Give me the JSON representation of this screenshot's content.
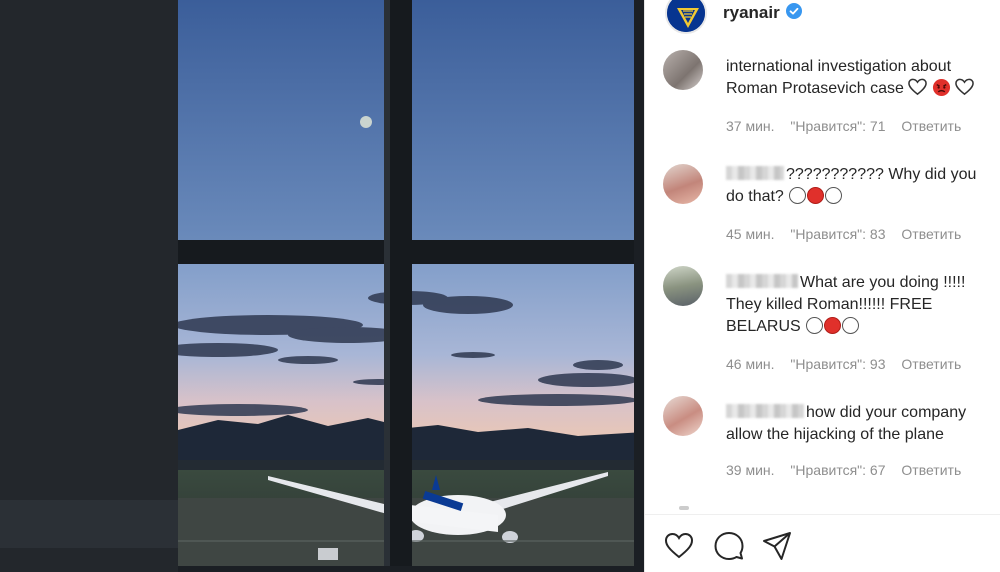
{
  "post": {
    "username": "ryanair",
    "verified": true,
    "brand_color": "#073590"
  },
  "comments": [
    {
      "text": "international investigation about Roman Protasevich case",
      "emojis": [
        "heart-outline-icon",
        "angry-face-icon",
        "heart-outline-icon"
      ],
      "time": "37 мин.",
      "likes": "\"Нравится\": 71",
      "reply": "Ответить"
    },
    {
      "text": "??????????? Why did you do that?",
      "emojis": [
        "white-circle-icon",
        "red-circle-icon",
        "white-circle-icon"
      ],
      "time": "45 мин.",
      "likes": "\"Нравится\": 83",
      "reply": "Ответить"
    },
    {
      "text": "What are you doing !!!!! They killed Roman!!!!!! FREE BELARUS",
      "emojis": [
        "white-circle-icon",
        "red-circle-icon",
        "white-circle-icon"
      ],
      "time": "46 мин.",
      "likes": "\"Нравится\": 93",
      "reply": "Ответить"
    },
    {
      "text": "how did your company allow the hijacking of the plane",
      "emojis": [],
      "time": "39 мин.",
      "likes": "\"Нравится\": 67",
      "reply": "Ответить"
    }
  ],
  "actions": [
    "heart-icon",
    "comment-icon",
    "share-icon"
  ]
}
